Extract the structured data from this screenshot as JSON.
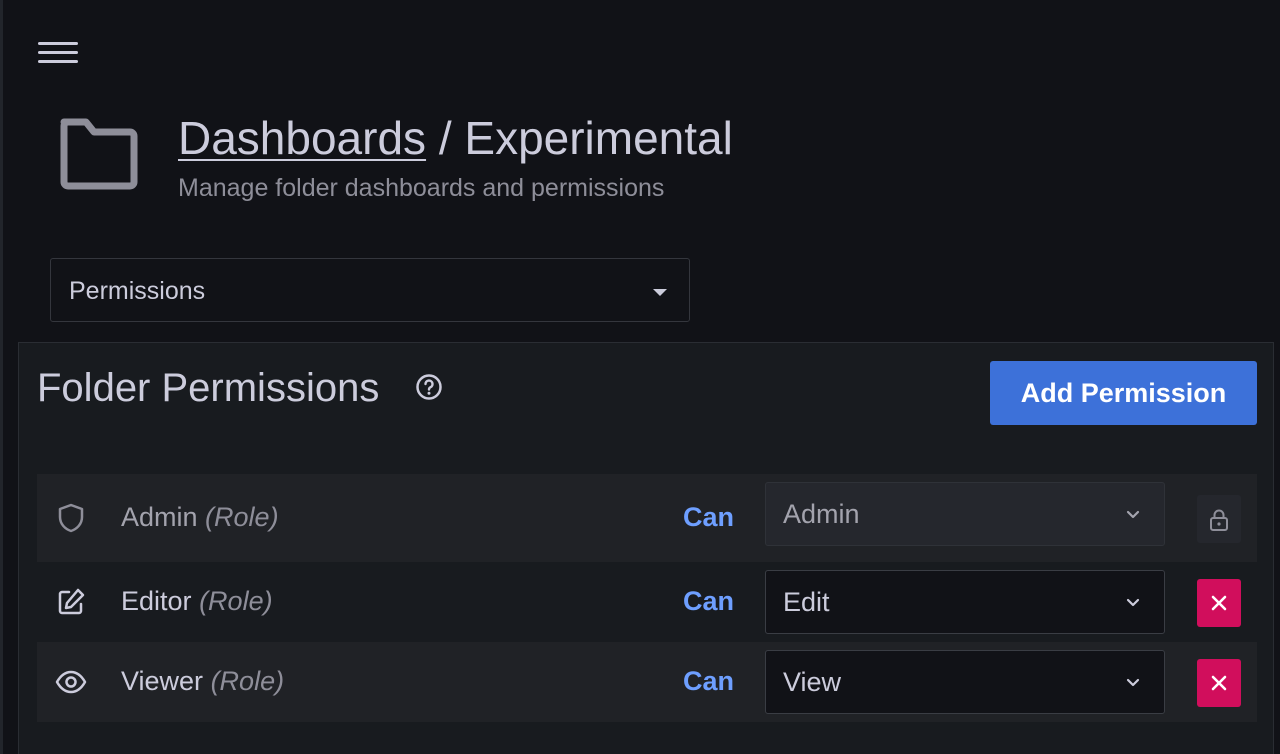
{
  "header": {
    "breadcrumb_link": "Dashboards",
    "breadcrumb_separator": " / ",
    "breadcrumb_current": "Experimental",
    "subtitle": "Manage folder dashboards and permissions"
  },
  "tab_select": {
    "selected": "Permissions"
  },
  "panel": {
    "title": "Folder Permissions",
    "add_button": "Add Permission"
  },
  "permissions": [
    {
      "name": "Admin",
      "role_suffix": "(Role)",
      "can": "Can",
      "level": "Admin",
      "icon": "shield-icon",
      "locked": true
    },
    {
      "name": "Editor",
      "role_suffix": "(Role)",
      "can": "Can",
      "level": "Edit",
      "icon": "edit-icon",
      "locked": false
    },
    {
      "name": "Viewer",
      "role_suffix": "(Role)",
      "can": "Can",
      "level": "View",
      "icon": "eye-icon",
      "locked": false
    }
  ],
  "colors": {
    "accent": "#3d71d9",
    "can_text": "#6e9fff",
    "remove": "#d10e5c",
    "background": "#111217"
  }
}
